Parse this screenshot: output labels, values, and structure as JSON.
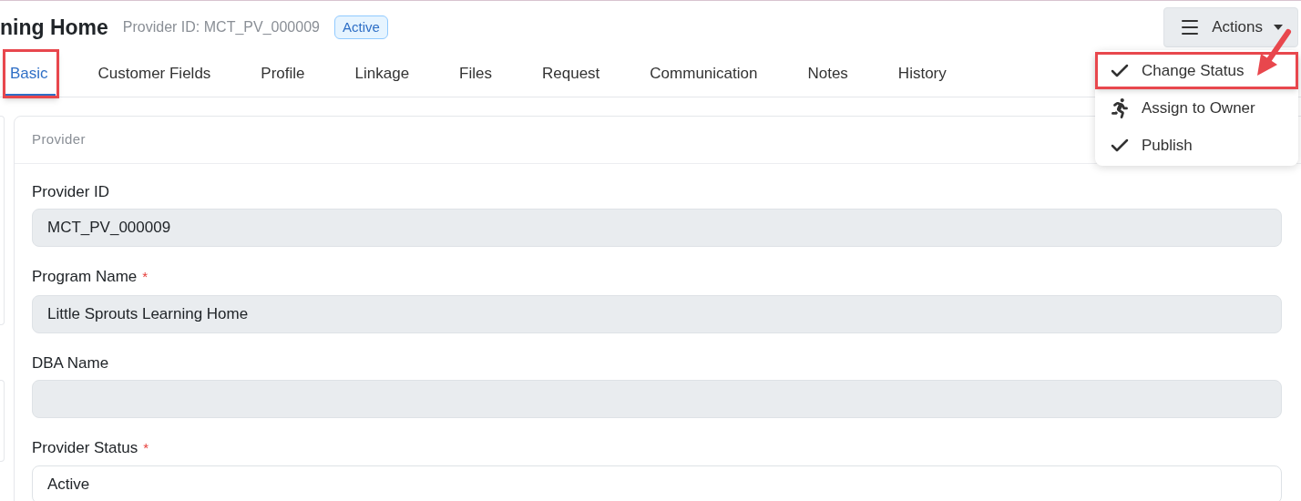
{
  "header": {
    "title": "ning Home",
    "provider_id": "Provider ID: MCT_PV_000009",
    "status_badge": "Active"
  },
  "actions": {
    "label": "Actions",
    "menu": [
      {
        "kind": "check",
        "label": "Change Status",
        "highlighted": true
      },
      {
        "kind": "run",
        "label": "Assign to Owner",
        "highlighted": false
      },
      {
        "kind": "check",
        "label": "Publish",
        "highlighted": false
      }
    ]
  },
  "tabs": [
    {
      "label": "Basic",
      "selected": true,
      "highlighted": true
    },
    {
      "label": "Customer Fields",
      "selected": false,
      "highlighted": false
    },
    {
      "label": "Profile",
      "selected": false,
      "highlighted": false
    },
    {
      "label": "Linkage",
      "selected": false,
      "highlighted": false
    },
    {
      "label": "Files",
      "selected": false,
      "highlighted": false
    },
    {
      "label": "Request",
      "selected": false,
      "highlighted": false
    },
    {
      "label": "Communication",
      "selected": false,
      "highlighted": false
    },
    {
      "label": "Notes",
      "selected": false,
      "highlighted": false
    },
    {
      "label": "History",
      "selected": false,
      "highlighted": false
    }
  ],
  "section": {
    "title": "Provider",
    "fields": [
      {
        "label": "Provider ID",
        "kind": "readonly",
        "value": "MCT_PV_000009"
      },
      {
        "label": "Program Name",
        "required_mark": "*",
        "kind": "readonly",
        "value": "Little Sprouts Learning Home"
      },
      {
        "label": "DBA Name",
        "kind": "readonly"
      },
      {
        "label": "Provider Status",
        "required_mark": "*",
        "kind": "editable",
        "value": "Active"
      }
    ]
  }
}
